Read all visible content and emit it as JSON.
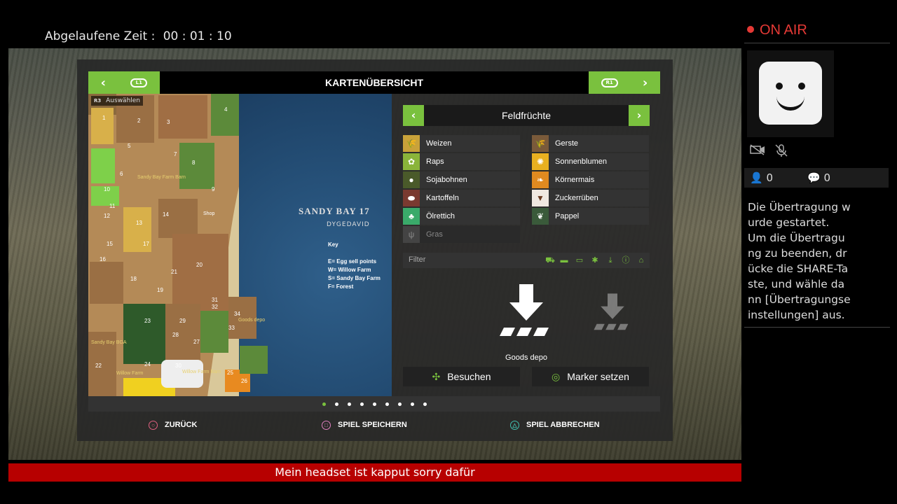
{
  "elapsed": {
    "label": "Abgelaufene Zeit :",
    "value": "00 : 01 : 10"
  },
  "stream": {
    "status": "ON AIR",
    "viewers": "0",
    "comments": "0",
    "message": "Die Übertragung w\nurde gestartet.\nUm die Übertragu\nng zu beenden, dr\nücke die SHARE-Ta\nste, und wähle da\nnn [Übertragungse\ninstellungen] aus."
  },
  "subtitle": "Mein headset ist kapput sorry dafür",
  "game": {
    "title": "KARTENÜBERSICHT",
    "left_button": "L1",
    "right_button": "R1",
    "select_hint": {
      "button": "R3",
      "label": "Auswählen"
    },
    "map": {
      "name": "SANDY BAY 17",
      "author": "DYGEDAVID",
      "key_title": "Key",
      "key_lines": [
        "E= Egg sell points",
        "W= Willow Farm",
        "S= Sandy Bay Farm",
        "F= Forest"
      ],
      "labels": [
        "1",
        "2",
        "3",
        "4",
        "5",
        "6",
        "7",
        "8",
        "9",
        "10",
        "11",
        "12",
        "13",
        "14",
        "15",
        "16",
        "17",
        "18",
        "19",
        "20",
        "21",
        "22",
        "23",
        "24",
        "25",
        "26",
        "27",
        "28",
        "29",
        "30",
        "31",
        "32",
        "33",
        "34"
      ],
      "place_labels": [
        "Sandy Bay Farm Barn",
        "Shop",
        "Sandy Bay BGA",
        "Goods depo",
        "Willow Farm Barn",
        "Willow Farm"
      ]
    },
    "category": "Feldfrüchte",
    "crops_left": [
      {
        "name": "Weizen",
        "icon": "wheat-icon",
        "color": "#c9a23a"
      },
      {
        "name": "Raps",
        "icon": "rapeseed-icon",
        "color": "#8ab43a"
      },
      {
        "name": "Sojabohnen",
        "icon": "soybean-icon",
        "color": "#4a5a2a"
      },
      {
        "name": "Kartoffeln",
        "icon": "potato-icon",
        "color": "#7a3a30"
      },
      {
        "name": "Ölrettich",
        "icon": "oilradish-icon",
        "color": "#3aaa6a"
      },
      {
        "name": "Gras",
        "icon": "grass-icon",
        "color": "#444444",
        "disabled": true
      }
    ],
    "crops_right": [
      {
        "name": "Gerste",
        "icon": "barley-icon",
        "color": "#7a5a3a"
      },
      {
        "name": "Sonnenblumen",
        "icon": "sunflower-icon",
        "color": "#e8b020"
      },
      {
        "name": "Körnermais",
        "icon": "maize-icon",
        "color": "#e08a20"
      },
      {
        "name": "Zuckerrüben",
        "icon": "sugarbeet-icon",
        "color": "#f0e8e0"
      },
      {
        "name": "Pappel",
        "icon": "poplar-icon",
        "color": "#3a5a3a"
      }
    ],
    "filter_placeholder": "Filter",
    "selected_place": "Goods depo",
    "actions": {
      "visit": "Besuchen",
      "marker": "Marker setzen"
    },
    "pages_total": 9,
    "page_active": 1,
    "footer": {
      "back": "ZURÜCK",
      "save": "SPIEL SPEICHERN",
      "quit": "SPIEL ABBRECHEN"
    },
    "accent": "#7ac13e"
  }
}
